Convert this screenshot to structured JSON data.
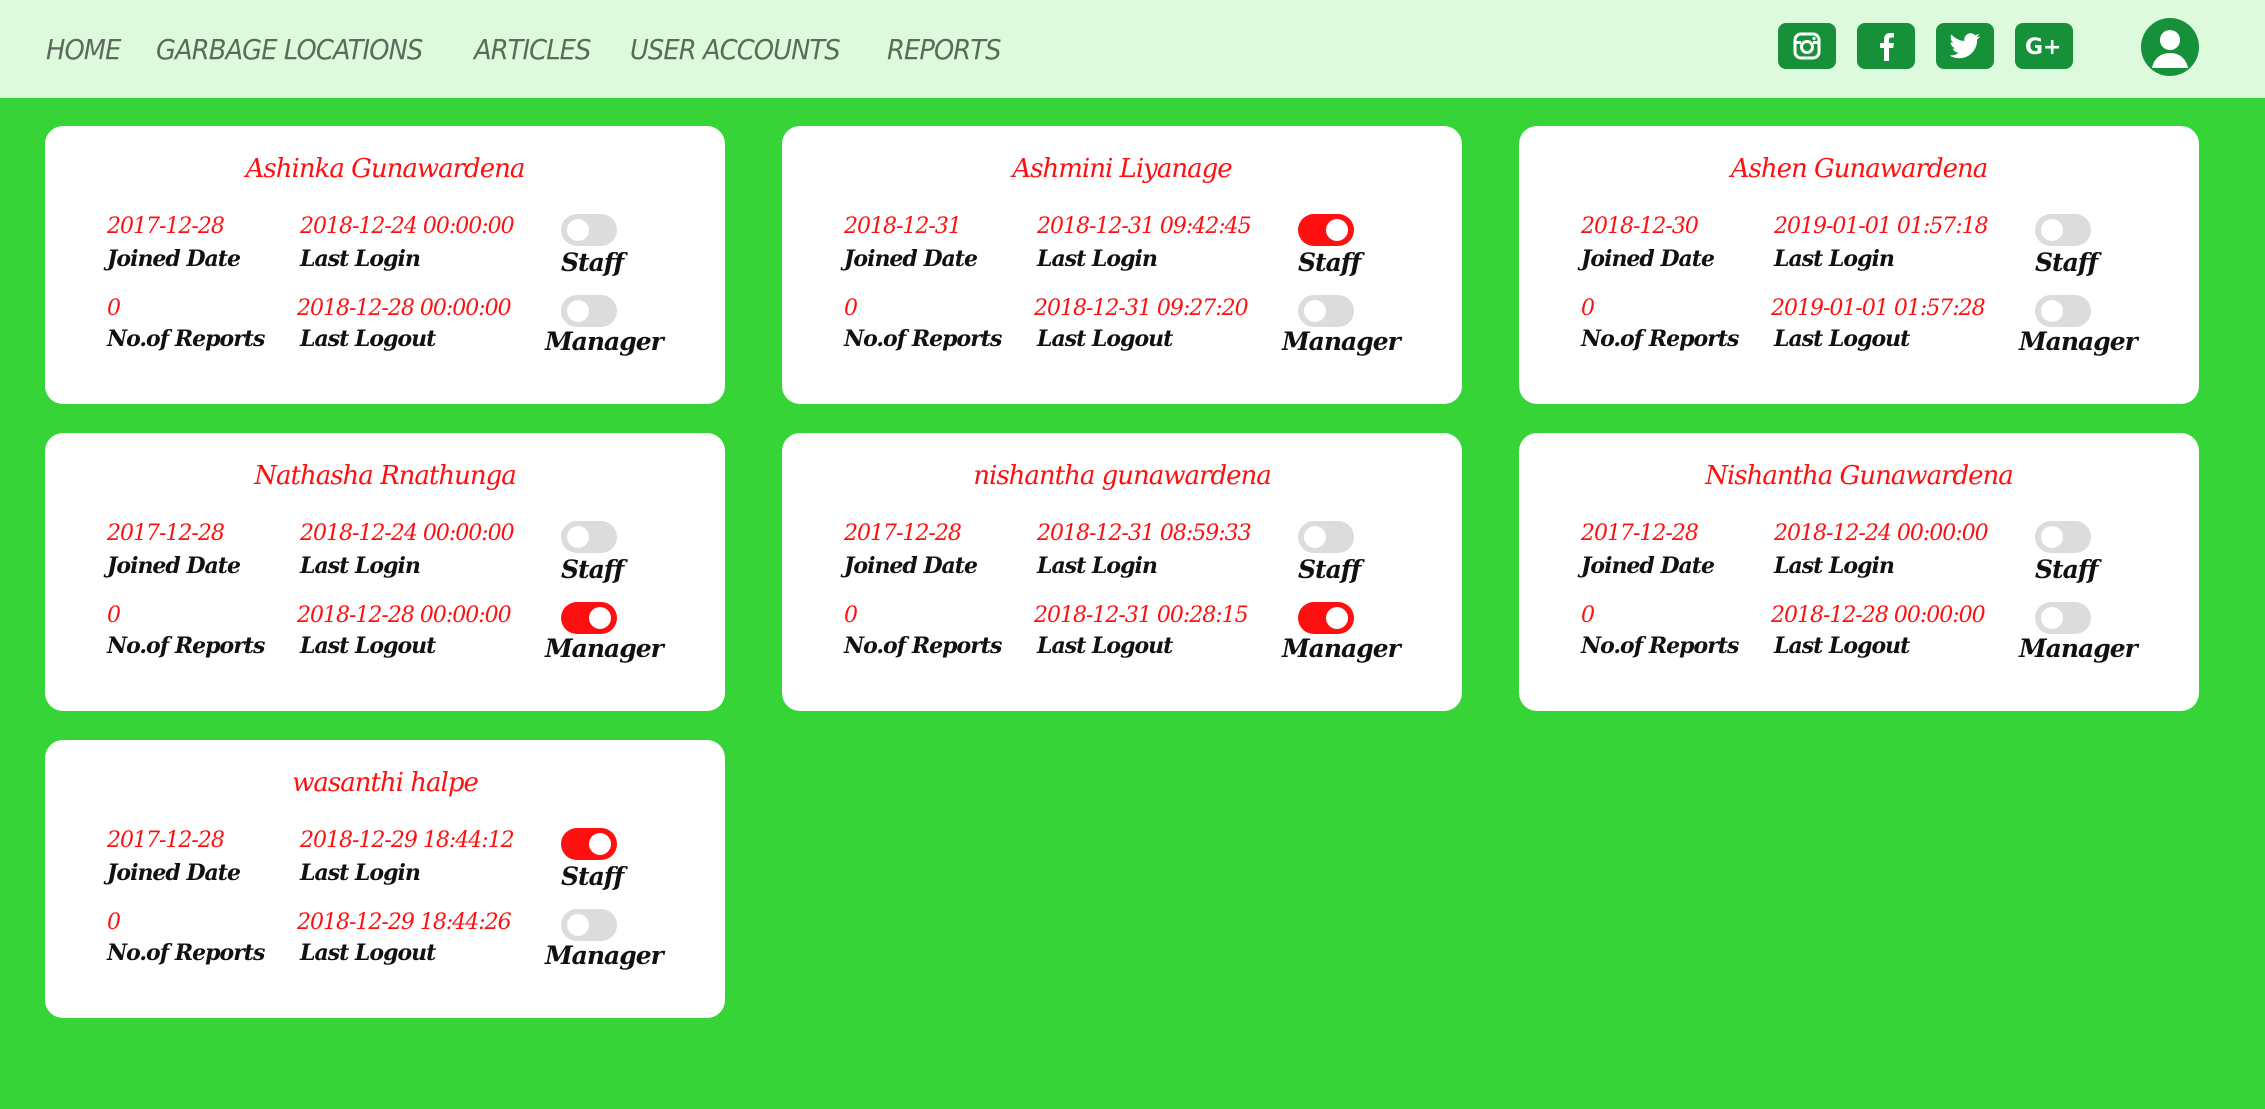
{
  "nav": {
    "items": [
      "HOME",
      "GARBAGE LOCATIONS",
      "ARTICLES",
      "USER ACCOUNTS",
      "REPORTS"
    ]
  },
  "socials": [
    "instagram-icon",
    "facebook-icon",
    "twitter-icon",
    "google-plus-icon"
  ],
  "labels": {
    "joined": "Joined Date",
    "last_login": "Last Login",
    "reports": "No.of Reports",
    "last_logout": "Last Logout",
    "staff": "Staff",
    "manager": "Manager"
  },
  "colors": {
    "background": "#36d436",
    "topbar": "#ddfadd",
    "accent_red": "#ff1010",
    "social_green": "#17903a"
  },
  "users": [
    {
      "name": "Ashinka Gunawardena",
      "joined": "2017-12-28",
      "last_login": "2018-12-24 00:00:00",
      "reports": "0",
      "last_logout": "2018-12-28 00:00:00",
      "staff": false,
      "manager": false
    },
    {
      "name": "Ashmini Liyanage",
      "joined": "2018-12-31",
      "last_login": "2018-12-31 09:42:45",
      "reports": "0",
      "last_logout": "2018-12-31 09:27:20",
      "staff": true,
      "manager": false
    },
    {
      "name": "Ashen Gunawardena",
      "joined": "2018-12-30",
      "last_login": "2019-01-01 01:57:18",
      "reports": "0",
      "last_logout": "2019-01-01 01:57:28",
      "staff": false,
      "manager": false
    },
    {
      "name": "Nathasha Rnathunga",
      "joined": "2017-12-28",
      "last_login": "2018-12-24 00:00:00",
      "reports": "0",
      "last_logout": "2018-12-28 00:00:00",
      "staff": false,
      "manager": true
    },
    {
      "name": "nishantha gunawardena",
      "joined": "2017-12-28",
      "last_login": "2018-12-31 08:59:33",
      "reports": "0",
      "last_logout": "2018-12-31 00:28:15",
      "staff": false,
      "manager": true
    },
    {
      "name": "Nishantha Gunawardena",
      "joined": "2017-12-28",
      "last_login": "2018-12-24 00:00:00",
      "reports": "0",
      "last_logout": "2018-12-28 00:00:00",
      "staff": false,
      "manager": false
    },
    {
      "name": "wasanthi halpe",
      "joined": "2017-12-28",
      "last_login": "2018-12-29 18:44:12",
      "reports": "0",
      "last_logout": "2018-12-29 18:44:26",
      "staff": true,
      "manager": false
    }
  ]
}
